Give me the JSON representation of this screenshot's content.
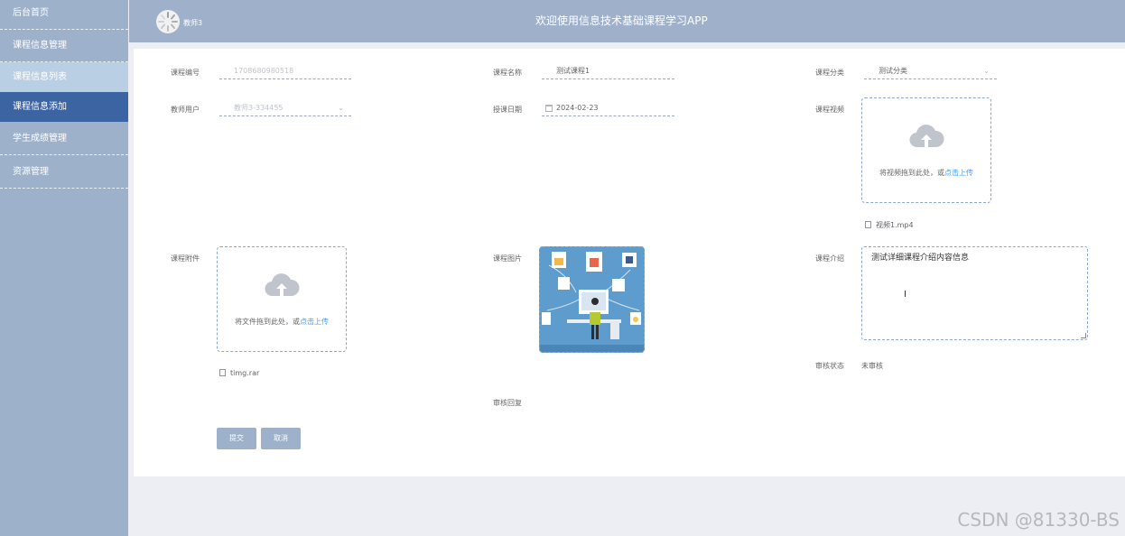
{
  "sidebar": {
    "items": [
      {
        "label": "后台首页"
      },
      {
        "label": "课程信息管理"
      },
      {
        "label": "课程信息列表"
      },
      {
        "label": "课程信息添加"
      },
      {
        "label": "学生成绩管理"
      },
      {
        "label": "资源管理"
      }
    ]
  },
  "header": {
    "user": "教师3",
    "title": "欢迎使用信息技术基础课程学习APP"
  },
  "form": {
    "course_no": {
      "label": "课程编号",
      "value": "1708680980518"
    },
    "course_name": {
      "label": "课程名称",
      "value": "测试课程1"
    },
    "course_category": {
      "label": "课程分类",
      "value": "测试分类"
    },
    "teacher_user": {
      "label": "教师用户",
      "value": "教师3-334455"
    },
    "teach_date": {
      "label": "授课日期",
      "value": "2024-02-23"
    },
    "course_video": {
      "label": "课程视频",
      "hint": "将视频拖到此处，或",
      "hint_link": "点击上传",
      "file": "视频1.mp4"
    },
    "course_attachment": {
      "label": "课程附件",
      "hint": "将文件拖到此处，或",
      "hint_link": "点击上传",
      "file": "timg.rar"
    },
    "course_image": {
      "label": "课程图片"
    },
    "course_intro": {
      "label": "课程介绍",
      "value": "测试详细课程介绍内容信息"
    },
    "review_status": {
      "label": "审核状态",
      "value": "未审核"
    },
    "review_reply": {
      "label": "审核回复"
    }
  },
  "buttons": {
    "submit": "提交",
    "cancel": "取消"
  },
  "watermark": "CSDN @81330-BS",
  "colors": {
    "sidebar": "#9db1cb",
    "active": "#3c64a2",
    "link": "#409eff"
  }
}
